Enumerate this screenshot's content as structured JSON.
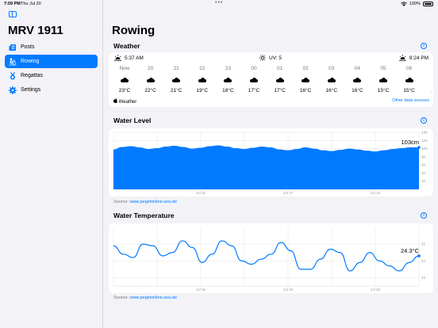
{
  "status_bar": {
    "time": "7:09 PM",
    "date": "Thu Jul 20",
    "dots": "•••",
    "battery": "100%"
  },
  "sidebar": {
    "title": "MRV 1911",
    "items": [
      {
        "label": "Posts",
        "icon": "newspaper-icon",
        "active": false
      },
      {
        "label": "Rowing",
        "icon": "rowing-icon",
        "active": true
      },
      {
        "label": "Regattas",
        "icon": "medal-icon",
        "active": false
      },
      {
        "label": "Settings",
        "icon": "gear-icon",
        "active": false
      }
    ]
  },
  "main": {
    "title": "Rowing"
  },
  "weather": {
    "section_title": "Weather",
    "sunrise": "5:37 AM",
    "uv": "UV: 5",
    "sunset": "9:24 PM",
    "hours": [
      {
        "label": "Now",
        "temp": "23°C",
        "icon": "cloud-icon"
      },
      {
        "label": "20",
        "temp": "22°C",
        "icon": "cloud-icon"
      },
      {
        "label": "21",
        "temp": "21°C",
        "icon": "cloud-icon"
      },
      {
        "label": "22",
        "temp": "19°C",
        "icon": "cloud-icon"
      },
      {
        "label": "23",
        "temp": "18°C",
        "icon": "cloud-icon"
      },
      {
        "label": "00",
        "temp": "17°C",
        "icon": "cloud-icon"
      },
      {
        "label": "01",
        "temp": "17°C",
        "icon": "cloud-icon"
      },
      {
        "label": "02",
        "temp": "16°C",
        "icon": "cloud-icon"
      },
      {
        "label": "03",
        "temp": "16°C",
        "icon": "cloud-icon"
      },
      {
        "label": "04",
        "temp": "16°C",
        "icon": "cloud-icon"
      },
      {
        "label": "05",
        "temp": "15°C",
        "icon": "cloud-icon"
      },
      {
        "label": "06",
        "temp": "15°C",
        "icon": "cloud-icon"
      }
    ],
    "attribution": "Weather",
    "other_sources": "Other data sources"
  },
  "chart_data": [
    {
      "type": "area",
      "title": "Water Level",
      "unit": "cm",
      "current_label": "103cm",
      "ylim": [
        0,
        140
      ],
      "yticks": [
        20,
        40,
        60,
        80,
        100,
        120,
        140
      ],
      "xticks": [
        "Jul 15",
        "Jul 17",
        "Jul 19"
      ],
      "values": [
        98,
        104,
        106,
        103,
        99,
        101,
        105,
        107,
        104,
        100,
        102,
        106,
        108,
        105,
        101,
        99,
        102,
        105,
        103,
        98,
        96,
        99,
        103,
        100,
        96,
        94,
        97,
        100,
        98,
        95,
        93,
        96,
        99,
        101,
        103,
        103
      ],
      "color": "#007aff",
      "source_prefix": "Source: ",
      "source_link": "www.pegelonline.wsv.de"
    },
    {
      "type": "line",
      "title": "Water Temperature",
      "unit": "°C",
      "current_label": "24.3°C",
      "ylim": [
        22.5,
        26
      ],
      "yticks": [
        23,
        24,
        25
      ],
      "xticks": [
        "Jul 16",
        "Jul 18",
        "Jul 20"
      ],
      "values": [
        24.9,
        24.4,
        24.2,
        25.0,
        24.9,
        24.3,
        24.5,
        25.2,
        24.8,
        23.9,
        24.4,
        25.2,
        24.9,
        24.0,
        23.8,
        24.1,
        24.4,
        25.1,
        24.6,
        23.5,
        23.5,
        24.1,
        24.7,
        24.5,
        23.4,
        23.9,
        24.5,
        24.0,
        23.7,
        23.4,
        23.9,
        24.3
      ],
      "color": "#007aff",
      "source_prefix": "Source: ",
      "source_link": "www.pegelonline.wsv.de"
    }
  ]
}
